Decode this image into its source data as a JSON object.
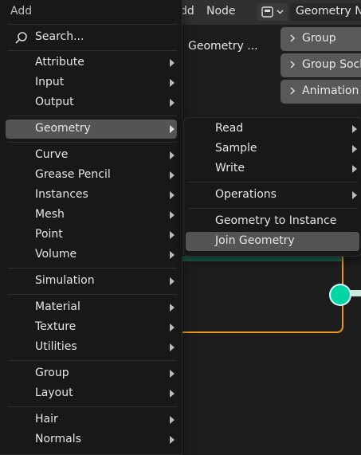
{
  "header": {
    "menu_add": "dd",
    "menu_node": "Node",
    "node_tree_name": "Geometry No"
  },
  "breadcrumb": "Geometry ...",
  "side_panels": [
    {
      "label": "Group"
    },
    {
      "label": "Group Sock"
    },
    {
      "label": "Animation"
    }
  ],
  "add_menu": {
    "title": "Add",
    "search_label": "Search...",
    "items": [
      {
        "label": "Attribute"
      },
      {
        "label": "Input"
      },
      {
        "label": "Output"
      },
      {
        "label": "Geometry"
      },
      {
        "label": "Curve"
      },
      {
        "label": "Grease Pencil"
      },
      {
        "label": "Instances"
      },
      {
        "label": "Mesh"
      },
      {
        "label": "Point"
      },
      {
        "label": "Volume"
      },
      {
        "label": "Simulation"
      },
      {
        "label": "Material"
      },
      {
        "label": "Texture"
      },
      {
        "label": "Utilities"
      },
      {
        "label": "Group"
      },
      {
        "label": "Layout"
      },
      {
        "label": "Hair"
      },
      {
        "label": "Normals"
      }
    ]
  },
  "geometry_menu": {
    "items": [
      {
        "label": "Read"
      },
      {
        "label": "Sample"
      },
      {
        "label": "Write"
      },
      {
        "label": "Operations"
      },
      {
        "label": "Geometry to Instance"
      },
      {
        "label": "Join Geometry"
      }
    ]
  },
  "colors": {
    "menu_bg": "#181818",
    "active_item": "#545454",
    "frame_orange": "#e89a18",
    "socket_green": "#00d6a3"
  }
}
